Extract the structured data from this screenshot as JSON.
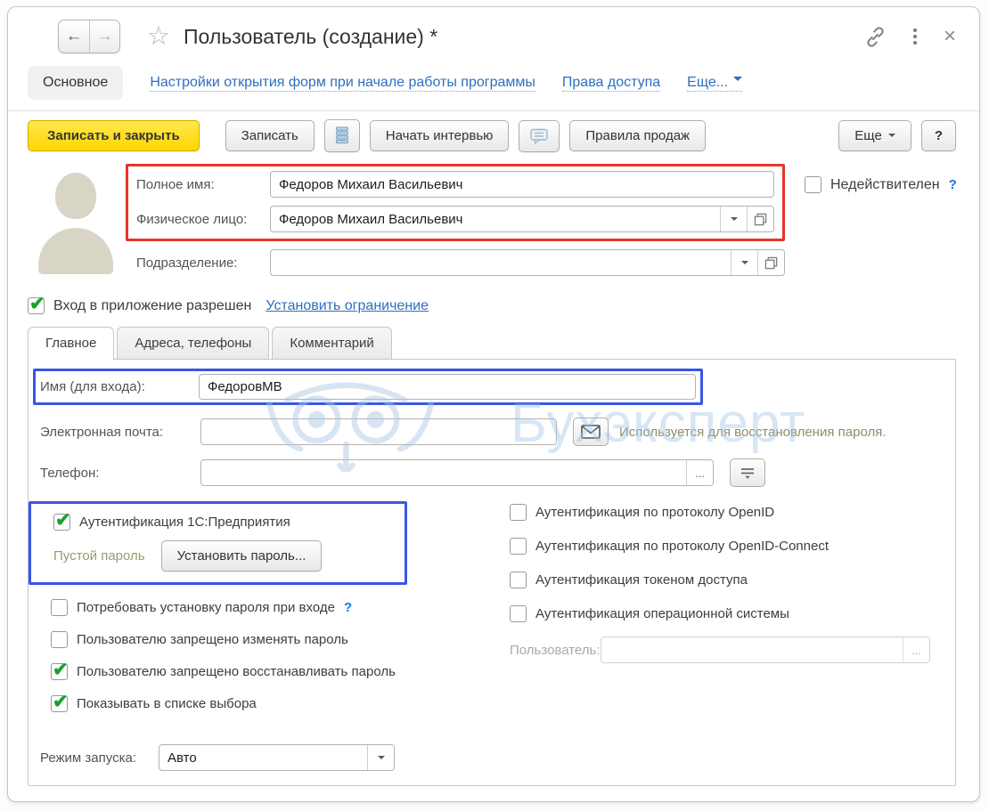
{
  "window": {
    "title": "Пользователь (создание) *"
  },
  "icons": {
    "back": "←",
    "forward": "→",
    "star": "☆",
    "close": "×",
    "ellipsis": "...",
    "help": "?",
    "more_caret": "▼"
  },
  "nav": {
    "primary_tab": "Основное",
    "links": [
      {
        "label": "Настройки открытия форм при начале работы программы"
      },
      {
        "label": "Права доступа"
      },
      {
        "label": "Еще..."
      }
    ]
  },
  "toolbar": {
    "save_close": "Записать и закрыть",
    "save": "Записать",
    "start_interview": "Начать интервью",
    "sales_rules": "Правила продаж",
    "more": "Еще",
    "help": "?"
  },
  "form": {
    "full_name": {
      "label": "Полное имя:",
      "value": "Федоров Михаил Васильевич"
    },
    "person": {
      "label": "Физическое лицо:",
      "value": "Федоров Михаил Васильевич"
    },
    "invalid": {
      "label": "Недействителен",
      "checked": false
    },
    "department": {
      "label": "Подразделение:",
      "value": ""
    },
    "login_allowed": {
      "label": "Вход в приложение разрешен",
      "checked": true,
      "link": "Установить ограничение"
    }
  },
  "tabs": [
    {
      "label": "Главное",
      "active": true
    },
    {
      "label": "Адреса, телефоны",
      "active": false
    },
    {
      "label": "Комментарий",
      "active": false
    }
  ],
  "main": {
    "login_name": {
      "label": "Имя (для входа):",
      "value": "ФедоровМВ"
    },
    "email": {
      "label": "Электронная почта:",
      "value": "",
      "hint": "Используется для восстановления пароля."
    },
    "phone": {
      "label": "Телефон:",
      "value": ""
    },
    "auth_1c": {
      "label": "Аутентификация 1С:Предприятия",
      "checked": true,
      "status": "Пустой пароль",
      "set_password": "Установить пароль..."
    },
    "password_options": [
      {
        "label": "Потребовать установку пароля при входе",
        "checked": false,
        "has_help": true
      },
      {
        "label": "Пользователю запрещено изменять пароль",
        "checked": false
      },
      {
        "label": "Пользователю запрещено восстанавливать пароль",
        "checked": true
      },
      {
        "label": "Показывать в списке выбора",
        "checked": true
      }
    ],
    "auth_options": [
      {
        "label": "Аутентификация по протоколу OpenID",
        "checked": false
      },
      {
        "label": "Аутентификация по протоколу OpenID-Connect",
        "checked": false
      },
      {
        "label": "Аутентификация токеном доступа",
        "checked": false
      },
      {
        "label": "Аутентификация операционной системы",
        "checked": false
      }
    ],
    "os_user": {
      "label": "Пользователь:",
      "value": ""
    },
    "launch_mode": {
      "label": "Режим запуска:",
      "value": "Авто"
    }
  },
  "watermark": {
    "text": "Бухэксперт"
  },
  "colors": {
    "accent_yellow": "#fed500",
    "highlight_red": "#e8342a",
    "highlight_blue": "#3b55e6",
    "check_green": "#17a22b",
    "link_blue": "#2e6fbe",
    "hint_olive": "#8e8e67",
    "watermark_blue": "#d5e5f3"
  }
}
